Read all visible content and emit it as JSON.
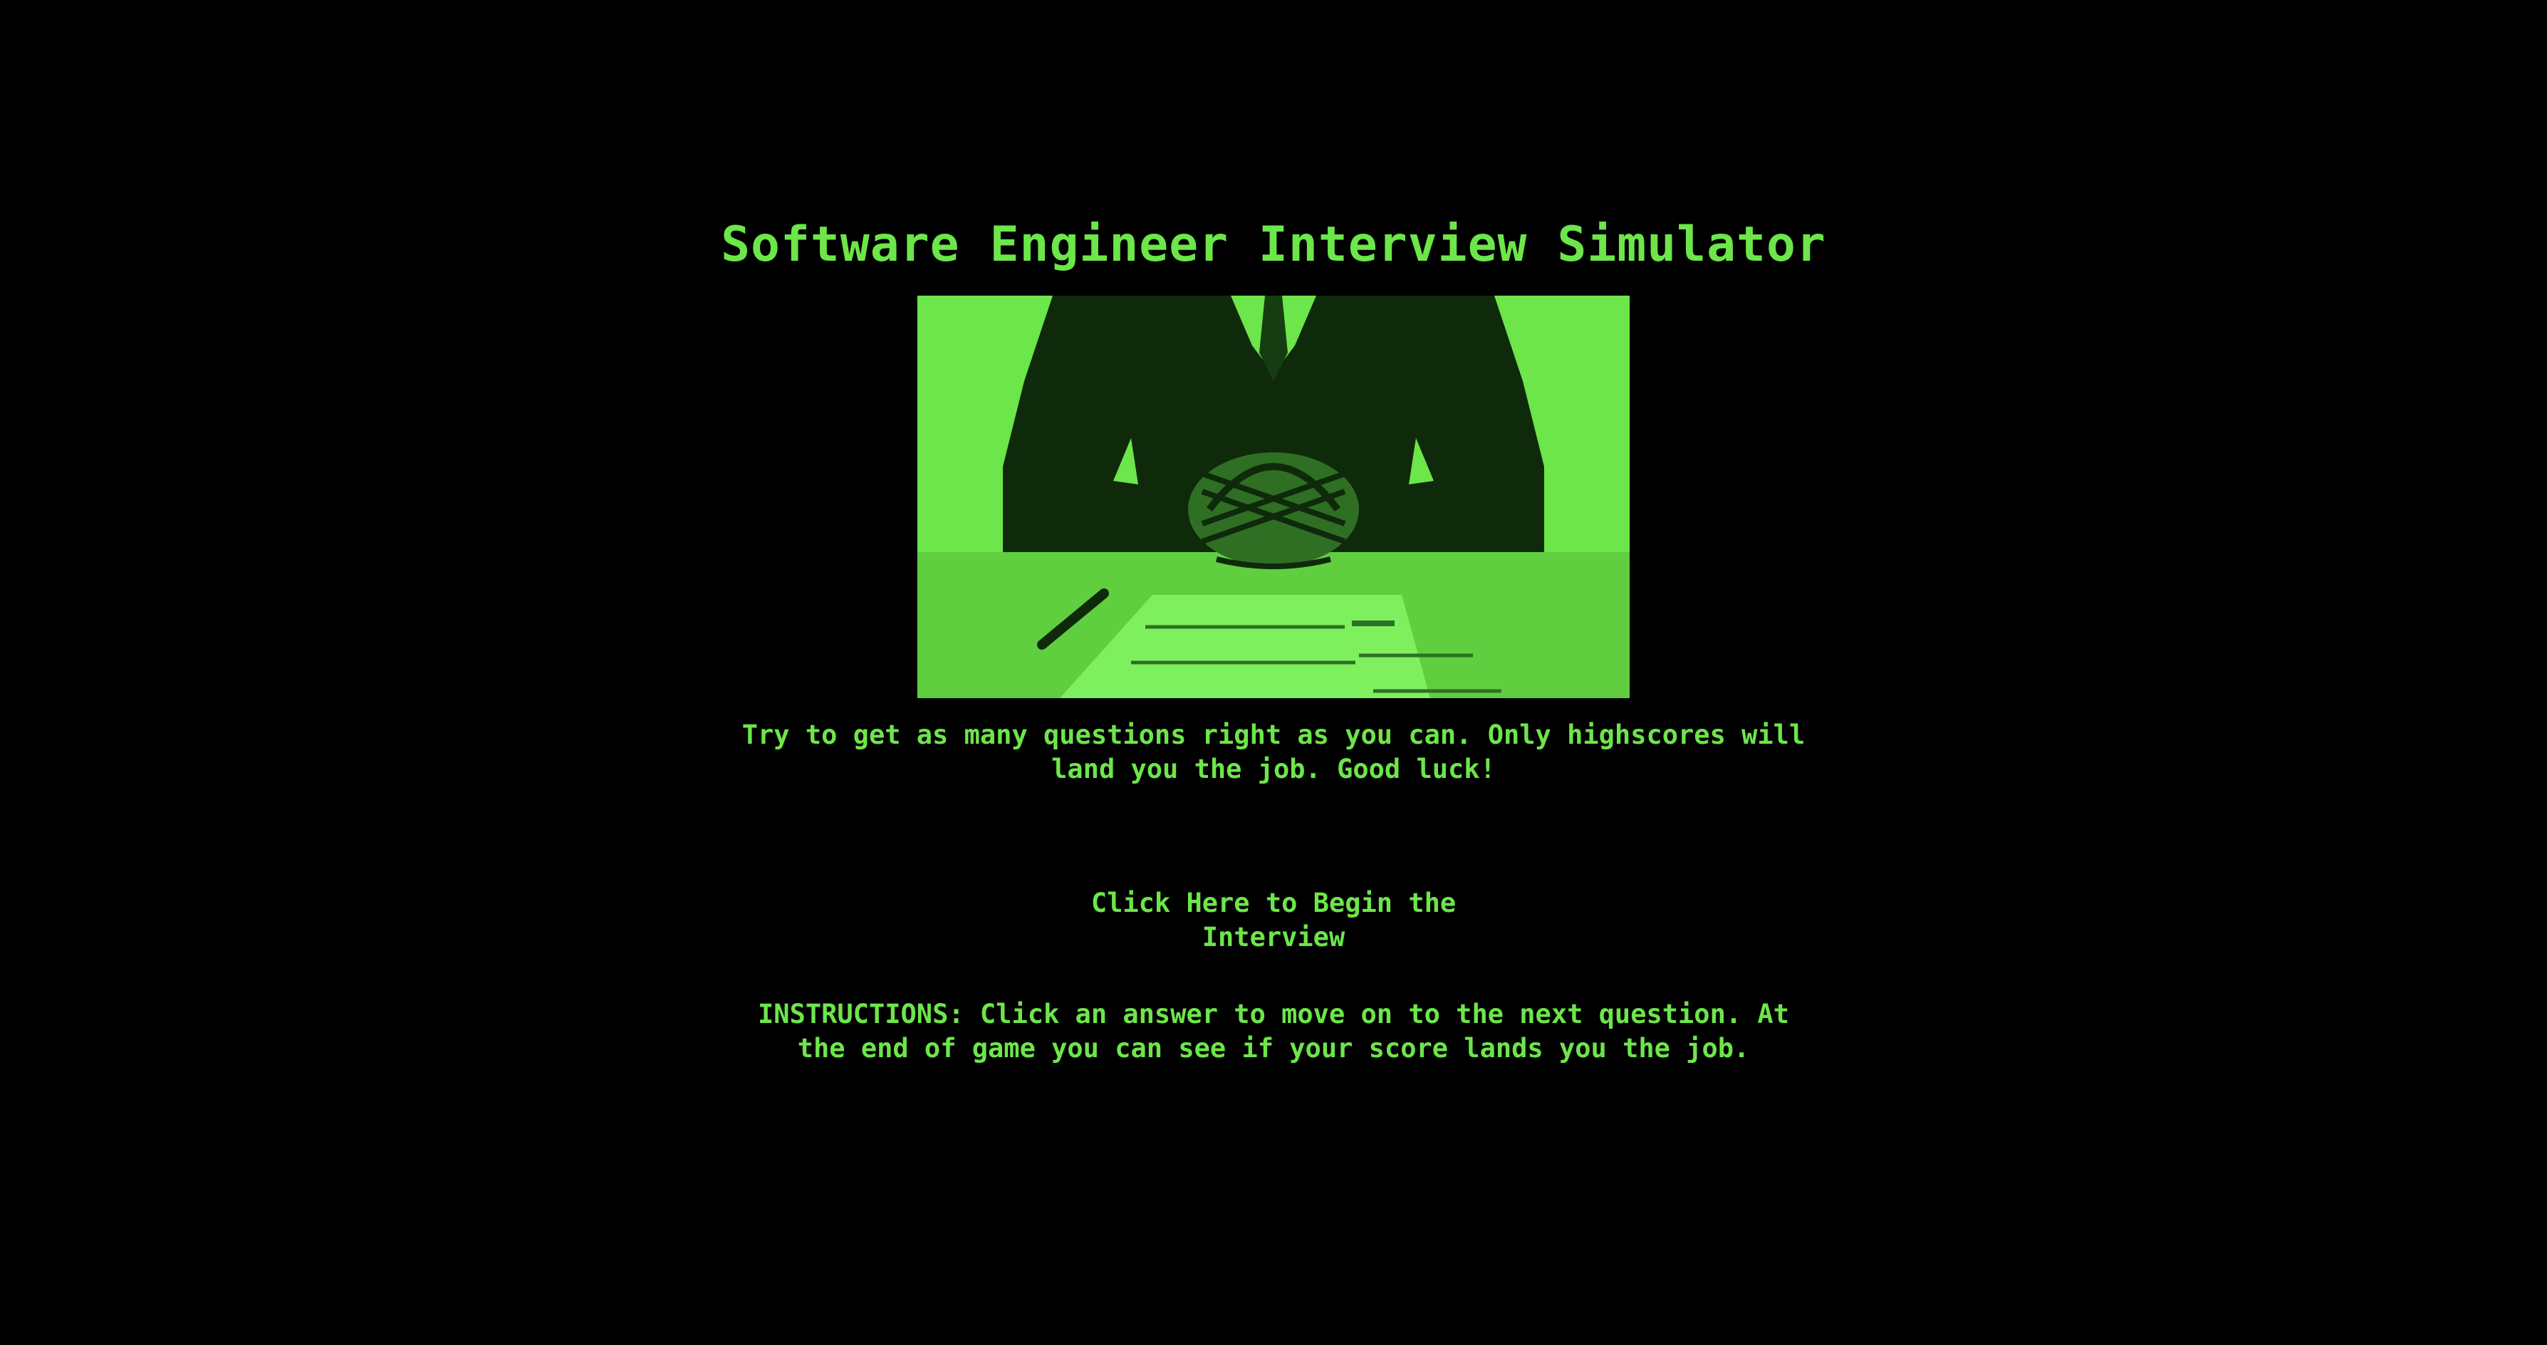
{
  "header": {
    "title": "Software Engineer Interview Simulator"
  },
  "hero": {
    "image_icon": "interviewer-hands-clasped-image"
  },
  "intro": {
    "tagline": "Try to get as many questions right as you can. Only highscores will land you the job. Good luck!"
  },
  "actions": {
    "begin_label": "Click Here to Begin the Interview"
  },
  "help": {
    "instructions": "INSTRUCTIONS: Click an answer to move on to the next question. At the end of game you can see if your score lands you the job."
  },
  "colors": {
    "background": "#000000",
    "accent": "#6ce64a",
    "shadow": "#0b2a08"
  }
}
